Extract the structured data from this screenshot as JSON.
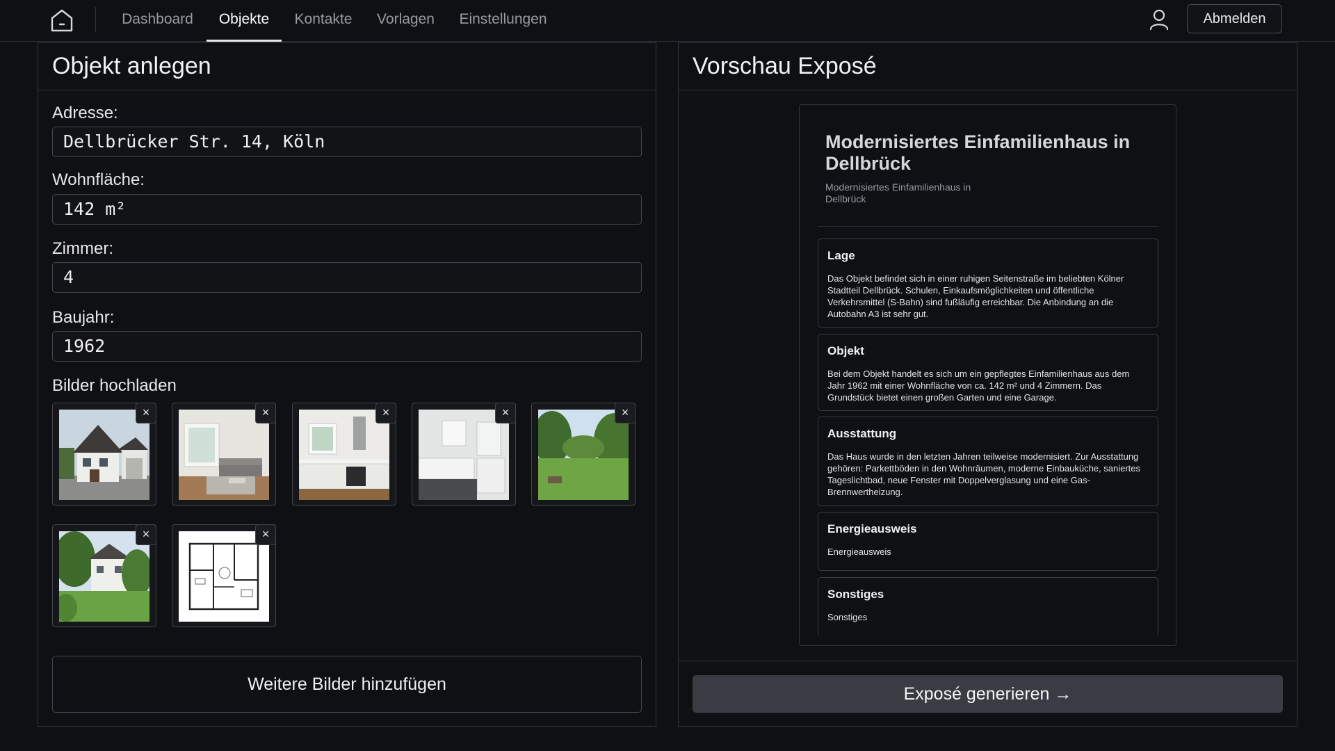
{
  "nav": {
    "tabs": [
      {
        "label": "Dashboard"
      },
      {
        "label": "Objekte"
      },
      {
        "label": "Kontakte"
      },
      {
        "label": "Vorlagen"
      },
      {
        "label": "Einstellungen"
      }
    ],
    "active_tab": "Objekte",
    "logout_label": "Abmelden",
    "home_icon": "home-icon",
    "user_icon": "user-icon"
  },
  "form": {
    "title": "Objekt anlegen",
    "address_label": "Adresse:",
    "address_value": "Dellbrücker Str. 14, Köln",
    "area_label": "Wohnfläche:",
    "area_value": "142 m²",
    "rooms_label": "Zimmer:",
    "rooms_value": "4",
    "year_label": "Baujahr:",
    "year_value": "1962",
    "upload_label": "Bilder hochladen",
    "images": [
      {
        "subject": "house-exterior"
      },
      {
        "subject": "living-room"
      },
      {
        "subject": "kitchen"
      },
      {
        "subject": "bathroom"
      },
      {
        "subject": "garden"
      },
      {
        "subject": "house-garden-view"
      },
      {
        "subject": "floor-plan"
      }
    ],
    "remove_glyph": "×",
    "add_more_label": "Weitere Bilder hinzufügen"
  },
  "preview": {
    "title": "Vorschau Exposé",
    "expose_title": "Modernisiertes Einfamilienhaus in Dellbrück",
    "expose_subtitle": "Modernisiertes Einfamilienhaus in Dellbrück",
    "sections": [
      {
        "title": "Lage",
        "body": "Das Objekt befindet sich in einer ruhigen Seitenstraße im beliebten Kölner Stadtteil Dellbrück. Schulen, Einkaufsmöglichkeiten und öffentliche Verkehrsmittel (S-Bahn) sind fußläufig erreichbar. Die Anbindung an die Autobahn A3 ist sehr gut."
      },
      {
        "title": "Objekt",
        "body": "Bei dem Objekt handelt es sich um ein gepflegtes Einfamilienhaus aus dem Jahr 1962 mit einer Wohnfläche von ca. 142 m² und 4 Zimmern. Das Grundstück bietet einen großen Garten und eine Garage."
      },
      {
        "title": "Ausstattung",
        "body": "Das Haus wurde in den letzten Jahren teilweise modernisiert. Zur Ausstattung gehören: Parkettböden in den Wohnräumen, moderne Einbauküche, saniertes Tageslichtbad, neue Fenster mit Doppelverglasung und eine Gas-Brennwertheizung."
      },
      {
        "title": "Energieausweis",
        "body": "Energieausweis"
      },
      {
        "title": "Sonstiges",
        "body": "Sonstiges"
      }
    ],
    "generate_label": "Exposé generieren →"
  },
  "colors": {
    "background": "#0f1014",
    "border": "#34353b",
    "button_primary": "#3a3c44",
    "text": "#e8e8ea",
    "muted_text": "#9a9ba2"
  }
}
